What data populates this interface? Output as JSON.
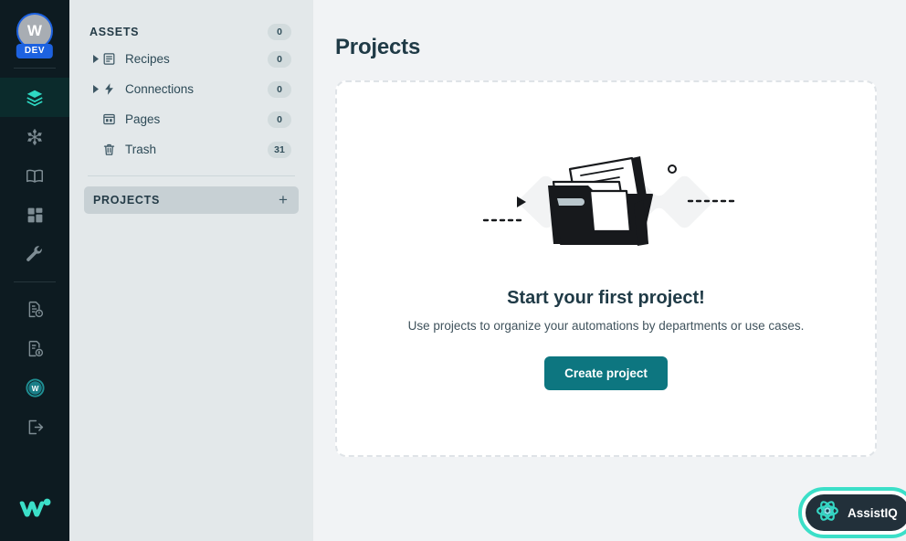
{
  "rail": {
    "avatar": {
      "initial": "W",
      "badge": "DEV"
    },
    "items": [
      {
        "name": "layers-icon",
        "label": "Assets",
        "active": true
      },
      {
        "name": "snowflake-icon",
        "label": "Workflows",
        "active": false
      },
      {
        "name": "book-icon",
        "label": "Documentation",
        "active": false
      },
      {
        "name": "dashboard-icon",
        "label": "Dashboard",
        "active": false
      },
      {
        "name": "wrench-icon",
        "label": "Tools",
        "active": false
      },
      {
        "name": "report-icon",
        "label": "Reports",
        "active": false
      },
      {
        "name": "billing-icon",
        "label": "Billing",
        "active": false
      },
      {
        "name": "workato-badge-icon",
        "label": "Account",
        "active": false
      },
      {
        "name": "logout-icon",
        "label": "Log out",
        "active": false
      }
    ],
    "logo_name": "workato-logo"
  },
  "assets": {
    "header": {
      "title": "ASSETS",
      "count": "0"
    },
    "items": [
      {
        "label": "Recipes",
        "count": "0",
        "icon": "recipes-icon",
        "expandable": true
      },
      {
        "label": "Connections",
        "count": "0",
        "icon": "connections-icon",
        "expandable": true
      },
      {
        "label": "Pages",
        "count": "0",
        "icon": "pages-icon",
        "expandable": false
      },
      {
        "label": "Trash",
        "count": "31",
        "icon": "trash-icon",
        "expandable": false
      }
    ],
    "projects": {
      "title": "PROJECTS",
      "add_label": "+"
    }
  },
  "main": {
    "page_title": "Projects",
    "empty_state": {
      "title": "Start your first project!",
      "subtitle": "Use projects to organize your automations by departments or use cases.",
      "button_label": "Create project",
      "illustration_name": "empty-folder-illustration"
    }
  },
  "assistiq": {
    "label": "AssistIQ",
    "icon": "atom-icon"
  },
  "colors": {
    "rail_bg": "#0d1b21",
    "rail_active_bg": "#0b2b2c",
    "accent_teal": "#2ed9c3",
    "panel_bg": "#e3e8ea",
    "main_bg": "#f1f3f5",
    "primary_button": "#0d7680",
    "badge_blue": "#1d62e0",
    "assist_ring": "#3bdfc8"
  }
}
